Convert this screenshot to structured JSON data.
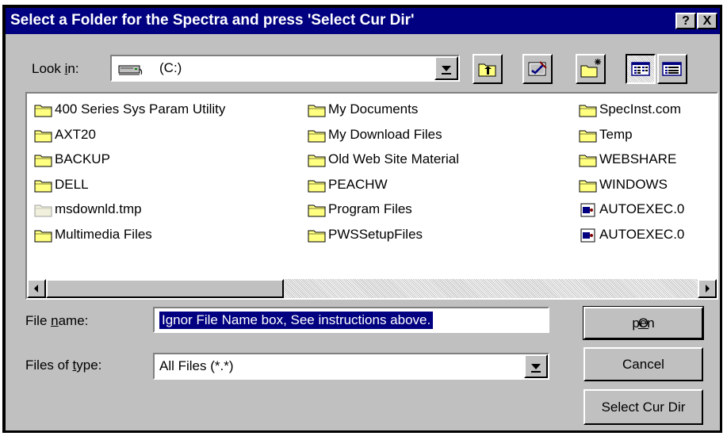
{
  "dialog": {
    "title": "Select a Folder for the Spectra and press 'Select Cur Dir'",
    "help_label": "?",
    "close_label": "X"
  },
  "look_in": {
    "label_pre": "Look ",
    "label_accel": "i",
    "label_post": "n:",
    "value": "(C:)"
  },
  "files": {
    "col1": [
      {
        "name": "400 Series Sys Param Utility",
        "icon": "folder-icon"
      },
      {
        "name": "AXT20",
        "icon": "folder-icon"
      },
      {
        "name": "BACKUP",
        "icon": "folder-icon"
      },
      {
        "name": "DELL",
        "icon": "folder-icon"
      },
      {
        "name": "msdownld.tmp",
        "icon": "hidden-folder-icon"
      },
      {
        "name": "Multimedia Files",
        "icon": "folder-icon"
      }
    ],
    "col2": [
      {
        "name": "My Documents",
        "icon": "folder-icon"
      },
      {
        "name": "My Download Files",
        "icon": "folder-icon"
      },
      {
        "name": "Old Web Site Material",
        "icon": "folder-icon"
      },
      {
        "name": "PEACHW",
        "icon": "folder-icon"
      },
      {
        "name": "Program Files",
        "icon": "folder-icon"
      },
      {
        "name": "PWSSetupFiles",
        "icon": "folder-icon"
      }
    ],
    "col3": [
      {
        "name": "SpecInst.com",
        "icon": "folder-icon"
      },
      {
        "name": "Temp",
        "icon": "folder-icon"
      },
      {
        "name": "WEBSHARE",
        "icon": "folder-icon"
      },
      {
        "name": "WINDOWS",
        "icon": "folder-icon"
      },
      {
        "name": "AUTOEXEC.0",
        "icon": "dos-file-icon"
      },
      {
        "name": "AUTOEXEC.0",
        "icon": "dos-file-icon"
      }
    ]
  },
  "filename": {
    "label_pre": "File ",
    "label_accel": "n",
    "label_post": "ame:",
    "value": "Ignor File Name box, See instructions above."
  },
  "filetype": {
    "label_pre": "Files of ",
    "label_accel": "t",
    "label_post": "ype:",
    "value": "All Files (*.*)"
  },
  "buttons": {
    "open_accel": "O",
    "open_rest": "pen",
    "cancel": "Cancel",
    "select_cur_dir": "Select Cur Dir"
  },
  "colors": {
    "titlebar": "#000080",
    "face": "#c0c0c0",
    "selection": "#000080"
  }
}
